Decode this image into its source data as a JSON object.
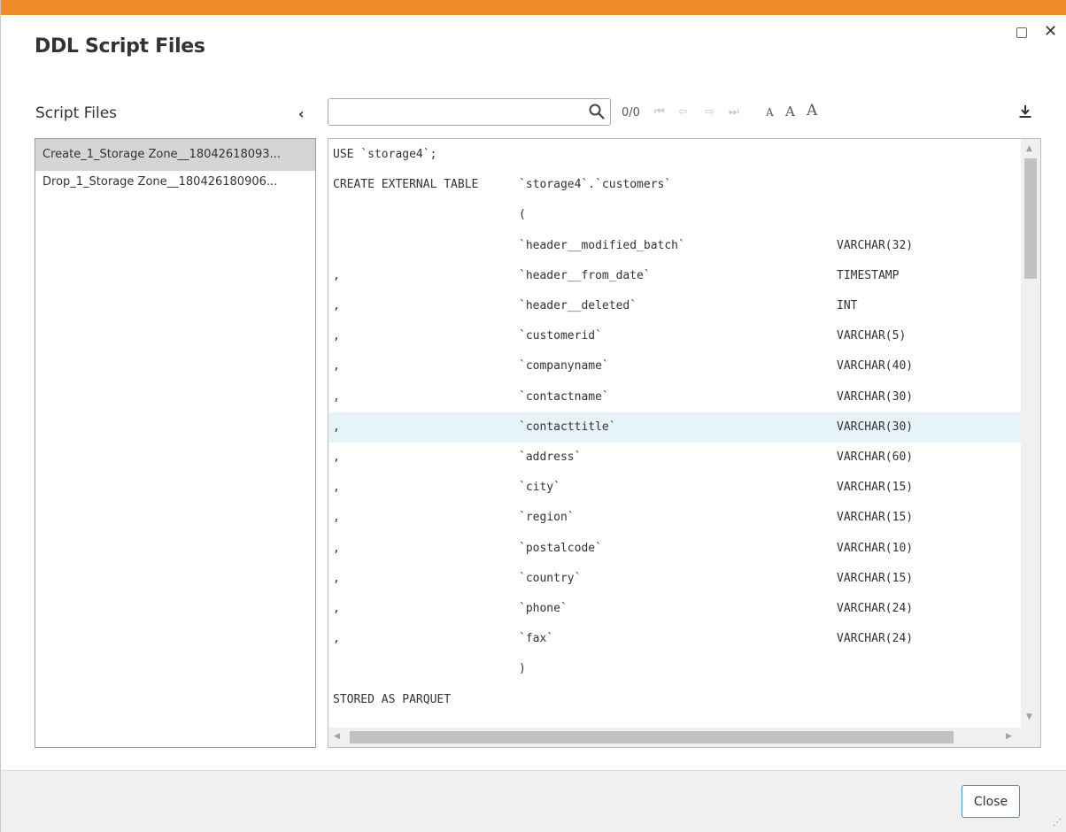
{
  "dialog": {
    "title": "DDL Script Files",
    "accent_color": "#f28c2b"
  },
  "sidebar": {
    "title": "Script Files",
    "files": [
      "Create_1_Storage Zone__18042618093...",
      "Drop_1_Storage Zone__180426180906..."
    ]
  },
  "toolbar": {
    "search_value": "",
    "search_placeholder": "",
    "match_count": "0/0",
    "font_buttons": [
      "A",
      "A",
      "A"
    ]
  },
  "editor": {
    "lines": [
      {
        "c1": "USE `storage4`;",
        "c2": "",
        "c3": ""
      },
      {
        "c1": "CREATE EXTERNAL TABLE",
        "c2": "`storage4`.`customers`",
        "c3": ""
      },
      {
        "c1": "",
        "c2": "(",
        "c3": ""
      },
      {
        "c1": "",
        "c2": "`header__modified_batch`",
        "c3": "VARCHAR(32)"
      },
      {
        "c1": ",",
        "c2": "`header__from_date`",
        "c3": "TIMESTAMP"
      },
      {
        "c1": ",",
        "c2": "`header__deleted`",
        "c3": "INT"
      },
      {
        "c1": ",",
        "c2": "`customerid`",
        "c3": "VARCHAR(5)"
      },
      {
        "c1": ",",
        "c2": "`companyname`",
        "c3": "VARCHAR(40)"
      },
      {
        "c1": ",",
        "c2": "`contactname`",
        "c3": "VARCHAR(30)"
      },
      {
        "c1": ",",
        "c2": "`contacttitle`",
        "c3": "VARCHAR(30)"
      },
      {
        "c1": ",",
        "c2": "`address`",
        "c3": "VARCHAR(60)"
      },
      {
        "c1": ",",
        "c2": "`city`",
        "c3": "VARCHAR(15)"
      },
      {
        "c1": ",",
        "c2": "`region`",
        "c3": "VARCHAR(15)"
      },
      {
        "c1": ",",
        "c2": "`postalcode`",
        "c3": "VARCHAR(10)"
      },
      {
        "c1": ",",
        "c2": "`country`",
        "c3": "VARCHAR(15)"
      },
      {
        "c1": ",",
        "c2": "`phone`",
        "c3": "VARCHAR(24)"
      },
      {
        "c1": ",",
        "c2": "`fax`",
        "c3": "VARCHAR(24)"
      },
      {
        "c1": "",
        "c2": ")",
        "c3": ""
      },
      {
        "c1": "STORED AS PARQUET",
        "c2": "",
        "c3": ""
      }
    ],
    "highlighted_line": 9
  },
  "footer": {
    "close_label": "Close"
  }
}
